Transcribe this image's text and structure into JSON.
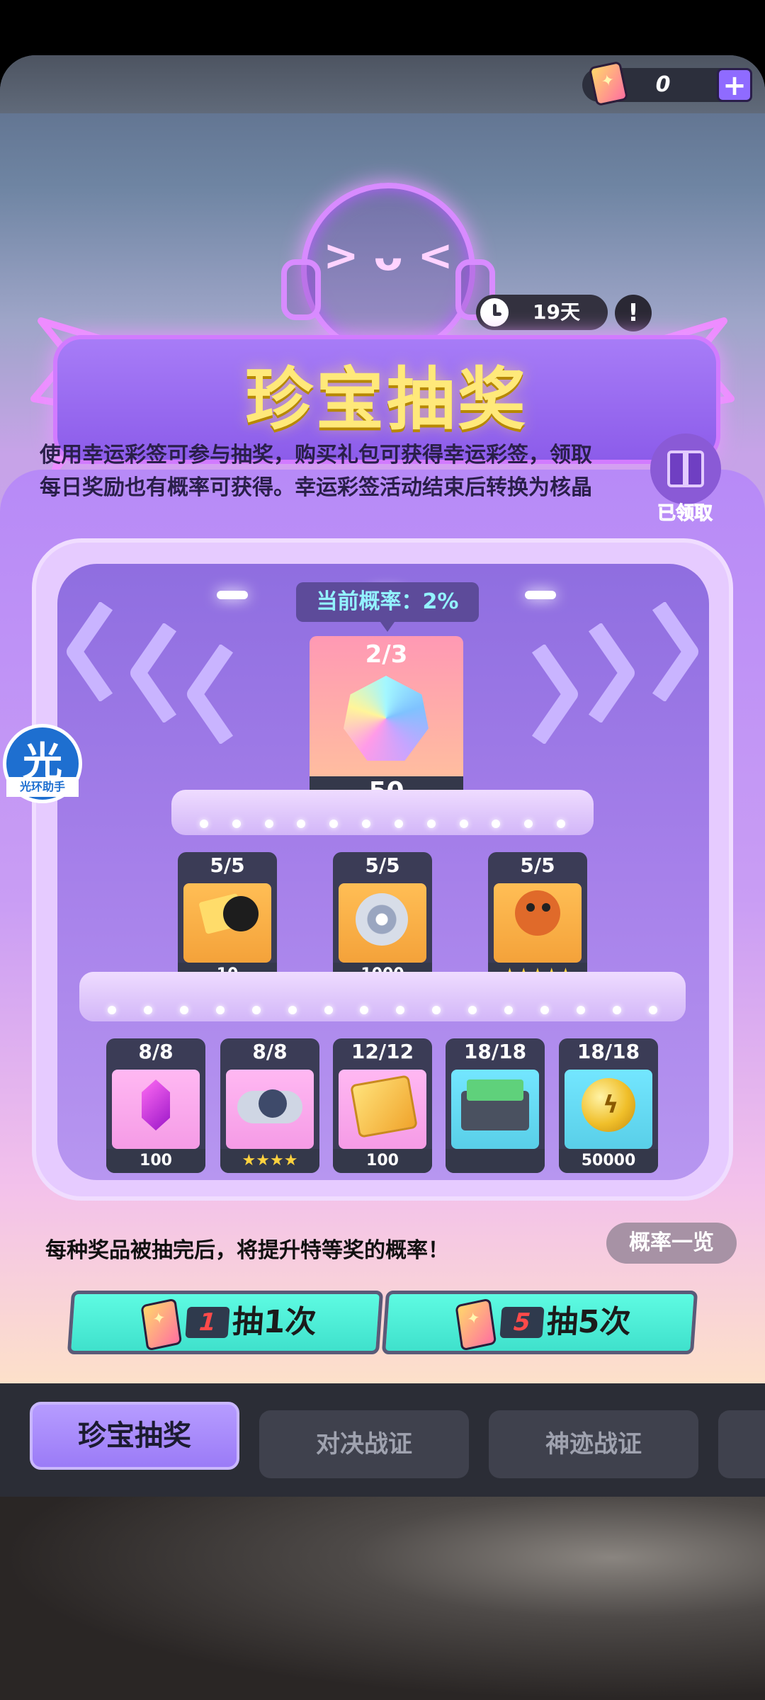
{
  "header": {
    "currency_count": "0",
    "plus_label": "+",
    "timer": "19天",
    "info_label": "!"
  },
  "title": "珍宝抽奖",
  "mascot_face": "> ᴗ <",
  "description": "使用幸运彩签可参与抽奖，购买礼包可获得幸运彩签，领取每日奖励也有概率可获得。幸运彩签活动结束后转换为核晶",
  "gift": {
    "label": "已领取"
  },
  "rate_tag": "当前概率：2%",
  "grand_prize": {
    "count": "2/3",
    "value": "50"
  },
  "row2": [
    {
      "count": "5/5",
      "value": "10",
      "color": "#f4a23a"
    },
    {
      "count": "5/5",
      "value": "1000",
      "color": "#f4a23a"
    },
    {
      "count": "5/5",
      "value": "★★★★★",
      "color": "#f4a23a"
    }
  ],
  "row3": [
    {
      "count": "8/8",
      "value": "100",
      "color": "#f59be6"
    },
    {
      "count": "8/8",
      "value": "★★★★",
      "color": "#f59be6"
    },
    {
      "count": "12/12",
      "value": "100",
      "color": "#ffb84a"
    },
    {
      "count": "18/18",
      "value": "",
      "color": "#59cfe8"
    },
    {
      "count": "18/18",
      "value": "50000",
      "color": "#59cfe8"
    }
  ],
  "hint": "每种奖品被抽完后，将提升特等奖的概率！",
  "rates_button": "概率一览",
  "draw_buttons": [
    {
      "cost": "1",
      "label": "抽1次"
    },
    {
      "cost": "5",
      "label": "抽5次"
    }
  ],
  "tabs": [
    {
      "label": "珍宝抽奖",
      "active": true
    },
    {
      "label": "对决战证",
      "active": false
    },
    {
      "label": "神迹战证",
      "active": false
    }
  ],
  "helper": {
    "big": "光",
    "small": "光环助手"
  },
  "colors": {
    "accent": "#9b7bf7",
    "teal": "#3fe1cc",
    "title": "#ffe97a"
  }
}
